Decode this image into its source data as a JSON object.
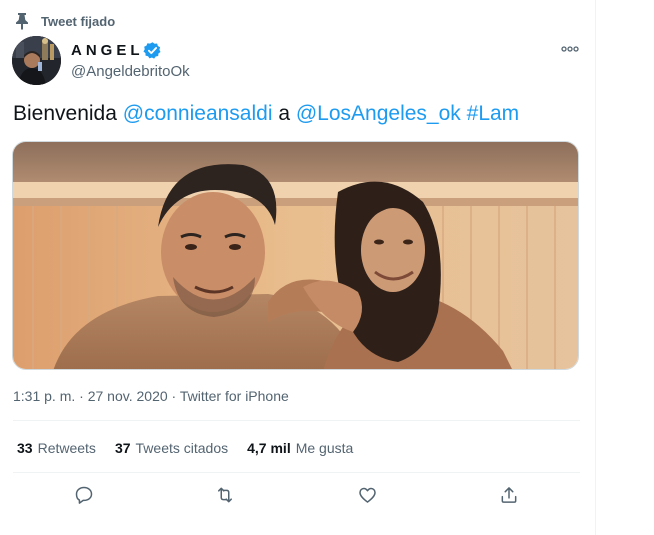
{
  "pinned": {
    "label": "Tweet fijado",
    "icon": "pin-icon"
  },
  "author": {
    "display_name": "ANGEL",
    "handle": "@AngeldebritoOk",
    "verified": true,
    "verified_icon": "verified-badge-icon",
    "avatar_icon": "avatar"
  },
  "tweet": {
    "text_parts": {
      "p1": "Bienvenida ",
      "mention1": "@connieansaldi",
      "p2": " a ",
      "mention2": "@LosAngeles_ok",
      "p3": " ",
      "hashtag": "#Lam"
    },
    "media": {
      "type": "photo",
      "description_icon": "tweet-photo"
    }
  },
  "meta": {
    "time": "1:31 p. m.",
    "separator1": " · ",
    "date": "27 nov. 2020",
    "separator2": " · ",
    "source": "Twitter for iPhone"
  },
  "stats": {
    "retweets": {
      "count": "33",
      "label": "Retweets"
    },
    "quotes": {
      "count": "37",
      "label": "Tweets citados"
    },
    "likes": {
      "count": "4,7 mil",
      "label": "Me gusta"
    }
  },
  "actions": {
    "reply": "reply-icon",
    "retweet": "retweet-icon",
    "like": "like-icon",
    "share": "share-icon"
  },
  "colors": {
    "link": "#1d9bf0",
    "text": "#0f1419",
    "secondary": "#536471",
    "divider": "#eff3f4",
    "verified": "#1d9bf0"
  }
}
